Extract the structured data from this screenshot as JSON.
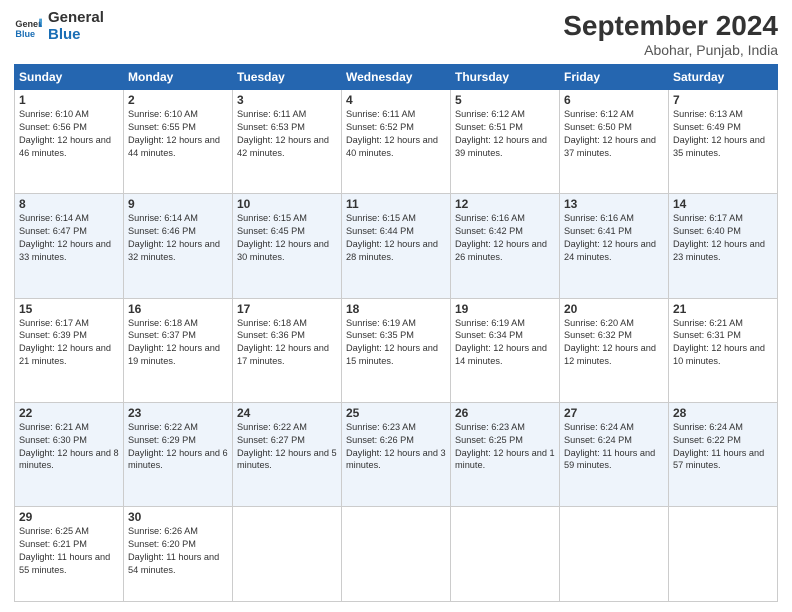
{
  "header": {
    "logo_general": "General",
    "logo_blue": "Blue",
    "month_title": "September 2024",
    "subtitle": "Abohar, Punjab, India"
  },
  "weekdays": [
    "Sunday",
    "Monday",
    "Tuesday",
    "Wednesday",
    "Thursday",
    "Friday",
    "Saturday"
  ],
  "weeks": [
    [
      {
        "day": "1",
        "sunrise": "6:10 AM",
        "sunset": "6:56 PM",
        "daylight": "12 hours and 46 minutes."
      },
      {
        "day": "2",
        "sunrise": "6:10 AM",
        "sunset": "6:55 PM",
        "daylight": "12 hours and 44 minutes."
      },
      {
        "day": "3",
        "sunrise": "6:11 AM",
        "sunset": "6:53 PM",
        "daylight": "12 hours and 42 minutes."
      },
      {
        "day": "4",
        "sunrise": "6:11 AM",
        "sunset": "6:52 PM",
        "daylight": "12 hours and 40 minutes."
      },
      {
        "day": "5",
        "sunrise": "6:12 AM",
        "sunset": "6:51 PM",
        "daylight": "12 hours and 39 minutes."
      },
      {
        "day": "6",
        "sunrise": "6:12 AM",
        "sunset": "6:50 PM",
        "daylight": "12 hours and 37 minutes."
      },
      {
        "day": "7",
        "sunrise": "6:13 AM",
        "sunset": "6:49 PM",
        "daylight": "12 hours and 35 minutes."
      }
    ],
    [
      {
        "day": "8",
        "sunrise": "6:14 AM",
        "sunset": "6:47 PM",
        "daylight": "12 hours and 33 minutes."
      },
      {
        "day": "9",
        "sunrise": "6:14 AM",
        "sunset": "6:46 PM",
        "daylight": "12 hours and 32 minutes."
      },
      {
        "day": "10",
        "sunrise": "6:15 AM",
        "sunset": "6:45 PM",
        "daylight": "12 hours and 30 minutes."
      },
      {
        "day": "11",
        "sunrise": "6:15 AM",
        "sunset": "6:44 PM",
        "daylight": "12 hours and 28 minutes."
      },
      {
        "day": "12",
        "sunrise": "6:16 AM",
        "sunset": "6:42 PM",
        "daylight": "12 hours and 26 minutes."
      },
      {
        "day": "13",
        "sunrise": "6:16 AM",
        "sunset": "6:41 PM",
        "daylight": "12 hours and 24 minutes."
      },
      {
        "day": "14",
        "sunrise": "6:17 AM",
        "sunset": "6:40 PM",
        "daylight": "12 hours and 23 minutes."
      }
    ],
    [
      {
        "day": "15",
        "sunrise": "6:17 AM",
        "sunset": "6:39 PM",
        "daylight": "12 hours and 21 minutes."
      },
      {
        "day": "16",
        "sunrise": "6:18 AM",
        "sunset": "6:37 PM",
        "daylight": "12 hours and 19 minutes."
      },
      {
        "day": "17",
        "sunrise": "6:18 AM",
        "sunset": "6:36 PM",
        "daylight": "12 hours and 17 minutes."
      },
      {
        "day": "18",
        "sunrise": "6:19 AM",
        "sunset": "6:35 PM",
        "daylight": "12 hours and 15 minutes."
      },
      {
        "day": "19",
        "sunrise": "6:19 AM",
        "sunset": "6:34 PM",
        "daylight": "12 hours and 14 minutes."
      },
      {
        "day": "20",
        "sunrise": "6:20 AM",
        "sunset": "6:32 PM",
        "daylight": "12 hours and 12 minutes."
      },
      {
        "day": "21",
        "sunrise": "6:21 AM",
        "sunset": "6:31 PM",
        "daylight": "12 hours and 10 minutes."
      }
    ],
    [
      {
        "day": "22",
        "sunrise": "6:21 AM",
        "sunset": "6:30 PM",
        "daylight": "12 hours and 8 minutes."
      },
      {
        "day": "23",
        "sunrise": "6:22 AM",
        "sunset": "6:29 PM",
        "daylight": "12 hours and 6 minutes."
      },
      {
        "day": "24",
        "sunrise": "6:22 AM",
        "sunset": "6:27 PM",
        "daylight": "12 hours and 5 minutes."
      },
      {
        "day": "25",
        "sunrise": "6:23 AM",
        "sunset": "6:26 PM",
        "daylight": "12 hours and 3 minutes."
      },
      {
        "day": "26",
        "sunrise": "6:23 AM",
        "sunset": "6:25 PM",
        "daylight": "12 hours and 1 minute."
      },
      {
        "day": "27",
        "sunrise": "6:24 AM",
        "sunset": "6:24 PM",
        "daylight": "11 hours and 59 minutes."
      },
      {
        "day": "28",
        "sunrise": "6:24 AM",
        "sunset": "6:22 PM",
        "daylight": "11 hours and 57 minutes."
      }
    ],
    [
      {
        "day": "29",
        "sunrise": "6:25 AM",
        "sunset": "6:21 PM",
        "daylight": "11 hours and 55 minutes."
      },
      {
        "day": "30",
        "sunrise": "6:26 AM",
        "sunset": "6:20 PM",
        "daylight": "11 hours and 54 minutes."
      },
      null,
      null,
      null,
      null,
      null
    ]
  ],
  "labels": {
    "sunrise": "Sunrise:",
    "sunset": "Sunset:",
    "daylight": "Daylight:"
  }
}
